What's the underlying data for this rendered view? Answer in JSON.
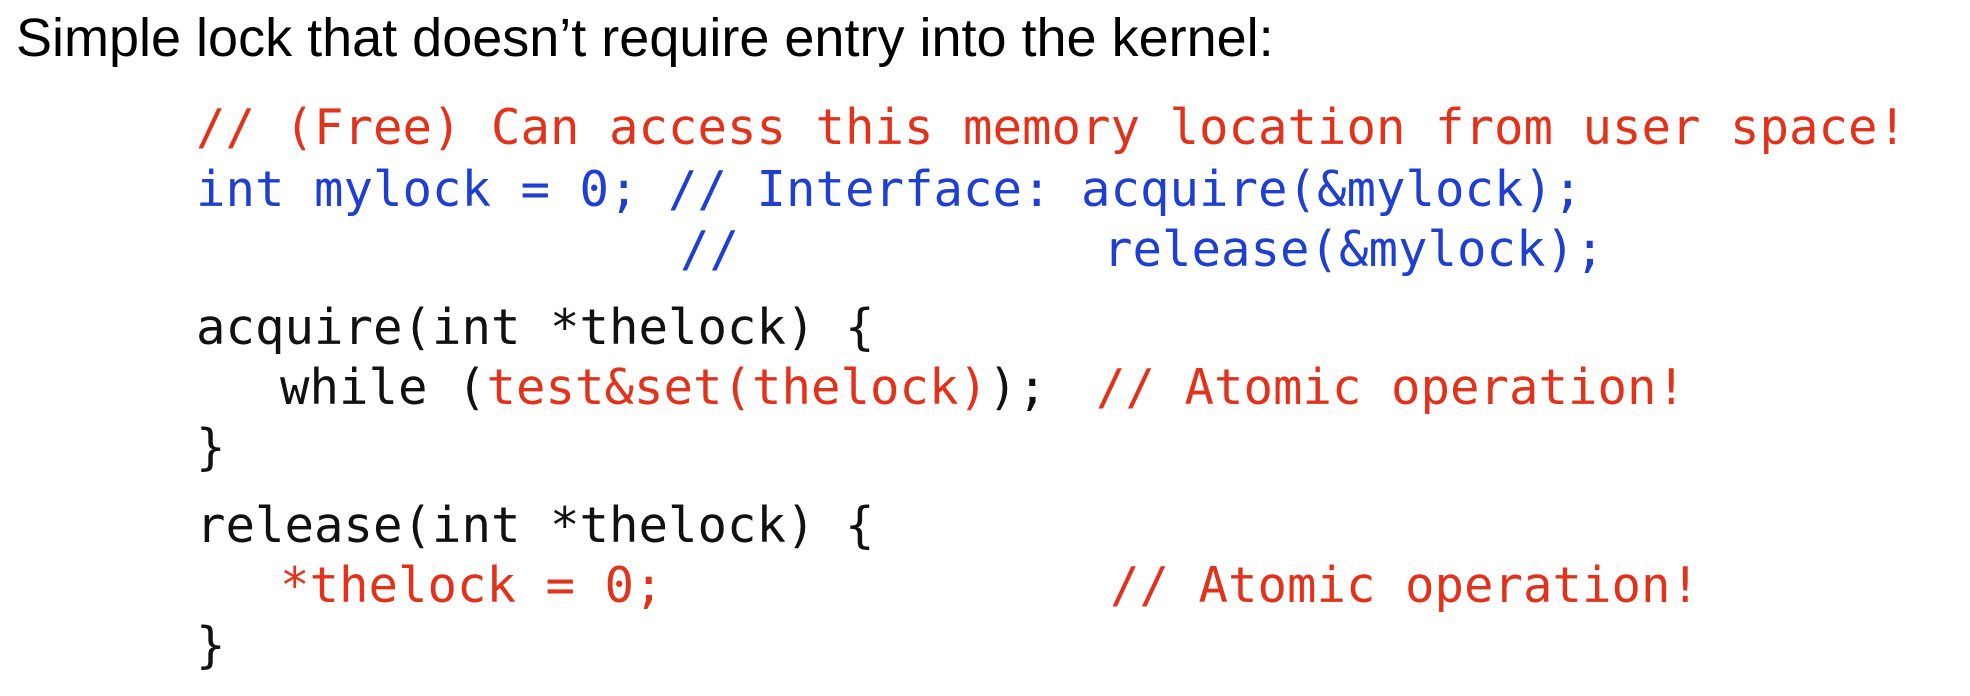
{
  "heading": "Simple lock that doesn’t require entry into the kernel:",
  "code": {
    "line1_comment": "// (Free) Can access this memory location from user space!",
    "line2_decl": "int mylock = 0; ",
    "line2_comment": "// Interface: acquire(&mylock);",
    "line3_comment_slashes": "//",
    "line3_release": "release(&mylock);",
    "line4": "acquire(int *thelock) {",
    "line5_while": "while (",
    "line5_call": "test&set(thelock)",
    "line5_end": ");",
    "line5_comment": "// Atomic operation!",
    "line6": "}",
    "line7": "release(int *thelock) {",
    "line8_stmt": "*thelock = 0;",
    "line8_comment": "// Atomic operation!",
    "line9": "}"
  },
  "colors": {
    "comment_red": "#e1331c",
    "declaration_blue": "#1f3fd0",
    "code_black": "#111111"
  }
}
